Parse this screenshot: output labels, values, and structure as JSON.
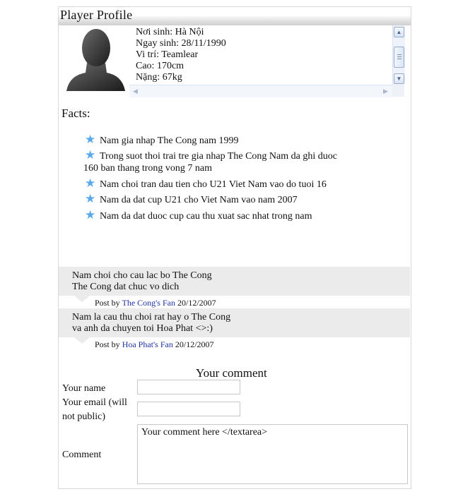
{
  "profile": {
    "title": "Player Profile",
    "info_lines": [
      "Nơi sinh: Hà Nội",
      "Ngay sinh: 28/11/1990",
      "Vi trí: Teamlear",
      "Cao: 170cm",
      "Nặng: 67kg"
    ]
  },
  "facts": {
    "heading": "Facts:",
    "items": [
      "Nam gia nhap The Cong nam 1999",
      "Trong suot thoi trai tre gia nhap The Cong Nam da ghi duoc 160 ban thang trong vong 7 nam",
      "Nam choi tran dau tien cho U21 Viet Nam vao do tuoi 16",
      "Nam da dat cup U21 cho Viet Nam vao nam 2007",
      "Nam da dat duoc cup cau thu xuat sac nhat trong nam"
    ]
  },
  "comments": [
    {
      "line1": "Nam choi cho cau lac bo The Cong",
      "line2": "The Cong dat chuc vo dich",
      "post_by": "Post by",
      "author": "The Cong's Fan",
      "date": "20/12/2007"
    },
    {
      "line1": "Nam la cau thu choi rat hay o The Cong",
      "line2": "va anh da chuyen toi Hoa Phat <>:)",
      "post_by": "Post by",
      "author": "Hoa Phat's Fan",
      "date": "20/12/2007"
    }
  ],
  "form": {
    "heading": "Your comment",
    "name_label": "Your name",
    "email_label_line1": "Your email (will",
    "email_label_line2": "not public)",
    "comment_label": "Comment",
    "comment_value": "Your comment here </textarea>"
  },
  "icons": {
    "star": "star-icon",
    "avatar": "avatar-silhouette",
    "scroll_up": "arrow-up-icon",
    "scroll_down": "arrow-down-icon",
    "scroll_left": "arrow-left-icon",
    "scroll_right": "arrow-right-icon"
  },
  "colors": {
    "star": "#5aa9ec",
    "link": "#1f33a6",
    "comment_bg": "#ebebeb"
  }
}
